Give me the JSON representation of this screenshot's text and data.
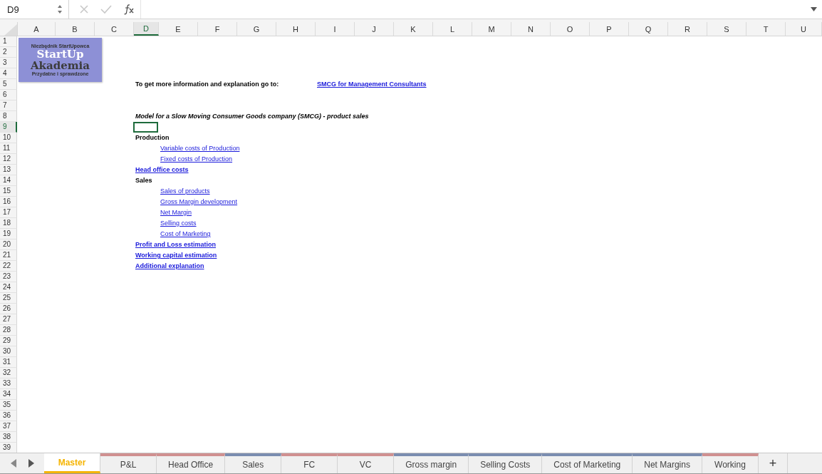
{
  "formula_bar": {
    "name_box": "D9"
  },
  "logo": {
    "tagline": "Niezbędnik StartUpowca",
    "line_1": "StartUp",
    "line_2": "Akademia",
    "footer": "Przydatne i sprawdzone"
  },
  "columns": [
    {
      "label": "A",
      "selected": false
    },
    {
      "label": "B",
      "selected": false
    },
    {
      "label": "C",
      "selected": false
    },
    {
      "label": "D",
      "selected": true
    },
    {
      "label": "E",
      "selected": false
    },
    {
      "label": "F",
      "selected": false
    },
    {
      "label": "G",
      "selected": false
    },
    {
      "label": "H",
      "selected": false
    },
    {
      "label": "I",
      "selected": false
    },
    {
      "label": "J",
      "selected": false
    },
    {
      "label": "K",
      "selected": false
    },
    {
      "label": "L",
      "selected": false
    },
    {
      "label": "M",
      "selected": false
    },
    {
      "label": "N",
      "selected": false
    },
    {
      "label": "O",
      "selected": false
    },
    {
      "label": "P",
      "selected": false
    },
    {
      "label": "Q",
      "selected": false
    },
    {
      "label": "R",
      "selected": false
    },
    {
      "label": "S",
      "selected": false
    },
    {
      "label": "T",
      "selected": false
    },
    {
      "label": "U",
      "selected": false
    }
  ],
  "rows": [
    {
      "number": "1",
      "selected": false
    },
    {
      "number": "2",
      "selected": false
    },
    {
      "number": "3",
      "selected": false
    },
    {
      "number": "4",
      "selected": false
    },
    {
      "number": "5",
      "selected": false,
      "cells": [
        {
          "kind": "bold",
          "text": "To get more information and explanation go to:"
        },
        {
          "kind": "side-link",
          "text": "SMCG for Management Consultants"
        }
      ]
    },
    {
      "number": "6",
      "selected": false
    },
    {
      "number": "7",
      "selected": false
    },
    {
      "number": "8",
      "selected": false,
      "cells": [
        {
          "kind": "bold-italic",
          "text": "Model for a Slow Moving Consumer Goods company (SMCG) - product sales"
        }
      ]
    },
    {
      "number": "9",
      "selected": true
    },
    {
      "number": "10",
      "selected": false,
      "cells": [
        {
          "kind": "bold",
          "text": "Production"
        }
      ]
    },
    {
      "number": "11",
      "selected": false,
      "cells": [
        {
          "kind": "link",
          "text": "Variable costs of Production"
        }
      ]
    },
    {
      "number": "12",
      "selected": false,
      "cells": [
        {
          "kind": "link",
          "text": "Fixed costs of Production"
        }
      ]
    },
    {
      "number": "13",
      "selected": false,
      "cells": [
        {
          "kind": "bold-link",
          "text": "Head office costs"
        }
      ]
    },
    {
      "number": "14",
      "selected": false,
      "cells": [
        {
          "kind": "bold",
          "text": "Sales"
        }
      ]
    },
    {
      "number": "15",
      "selected": false,
      "cells": [
        {
          "kind": "link",
          "text": "Sales of products"
        }
      ]
    },
    {
      "number": "16",
      "selected": false,
      "cells": [
        {
          "kind": "link",
          "text": "Gross Margin development"
        }
      ]
    },
    {
      "number": "17",
      "selected": false,
      "cells": [
        {
          "kind": "link",
          "text": "Net Margin"
        }
      ]
    },
    {
      "number": "18",
      "selected": false,
      "cells": [
        {
          "kind": "link",
          "text": "Selling costs"
        }
      ]
    },
    {
      "number": "19",
      "selected": false,
      "cells": [
        {
          "kind": "link",
          "text": "Cost of Marketing"
        }
      ]
    },
    {
      "number": "20",
      "selected": false,
      "cells": [
        {
          "kind": "bold-link",
          "text": "Profit and Loss estimation"
        }
      ]
    },
    {
      "number": "21",
      "selected": false,
      "cells": [
        {
          "kind": "bold-link",
          "text": "Working capital estimation"
        }
      ]
    },
    {
      "number": "22",
      "selected": false,
      "cells": [
        {
          "kind": "bold-link",
          "text": "Additional explanation"
        }
      ]
    },
    {
      "number": "23",
      "selected": false
    },
    {
      "number": "24",
      "selected": false
    },
    {
      "number": "25",
      "selected": false
    },
    {
      "number": "26",
      "selected": false
    },
    {
      "number": "27",
      "selected": false
    },
    {
      "number": "28",
      "selected": false
    },
    {
      "number": "29",
      "selected": false
    },
    {
      "number": "30",
      "selected": false
    },
    {
      "number": "31",
      "selected": false
    },
    {
      "number": "32",
      "selected": false
    },
    {
      "number": "33",
      "selected": false
    },
    {
      "number": "34",
      "selected": false
    },
    {
      "number": "35",
      "selected": false
    },
    {
      "number": "36",
      "selected": false
    },
    {
      "number": "37",
      "selected": false
    },
    {
      "number": "38",
      "selected": false
    },
    {
      "number": "39",
      "selected": false
    }
  ],
  "sheet_tabs": [
    {
      "label": "Master",
      "selected": true,
      "color": "#f5b400"
    },
    {
      "label": "P&L",
      "selected": false,
      "color": "#d09090"
    },
    {
      "label": "Head Office",
      "selected": false,
      "color": "#d09090"
    },
    {
      "label": "Sales",
      "selected": false,
      "color": "#7a8db0"
    },
    {
      "label": "FC",
      "selected": false,
      "color": "#d09090"
    },
    {
      "label": "VC",
      "selected": false,
      "color": "#d09090"
    },
    {
      "label": "Gross margin",
      "selected": false,
      "color": "#7a8db0"
    },
    {
      "label": "Selling Costs",
      "selected": false,
      "color": "#7a8db0"
    },
    {
      "label": "Cost of Marketing",
      "selected": false,
      "color": "#7a8db0"
    },
    {
      "label": "Net Margins",
      "selected": false,
      "color": "#7a8db0"
    },
    {
      "label": "Working",
      "selected": false,
      "color": "#d09090"
    }
  ],
  "add_sheet": "+"
}
